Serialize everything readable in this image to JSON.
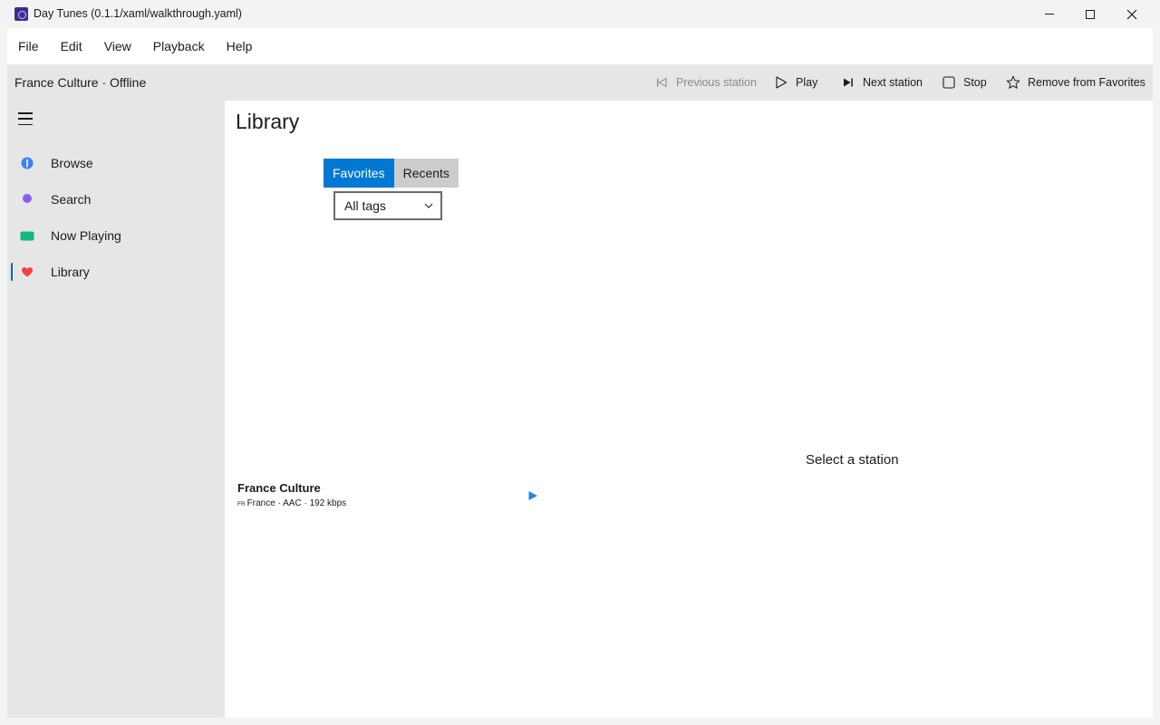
{
  "window": {
    "title": "Day Tunes (0.1.1/xaml/walkthrough.yaml)"
  },
  "menu": {
    "items": [
      "File",
      "Edit",
      "View",
      "Playback",
      "Help"
    ]
  },
  "toolbar": {
    "status": "France Culture · Offline",
    "previous_label": "Previous station",
    "play_label": "Play",
    "next_label": "Next station",
    "stop_label": "Stop",
    "favorite_label": "Remove from Favorites"
  },
  "nav": {
    "items": [
      {
        "label": "Browse",
        "icon": "compass-icon",
        "color": "#3b82f6"
      },
      {
        "label": "Search",
        "icon": "search-icon",
        "color": "#8b5cf6"
      },
      {
        "label": "Now Playing",
        "icon": "now-playing-icon",
        "color": "#10b981"
      },
      {
        "label": "Library",
        "icon": "heart-icon",
        "color": "#ef4444"
      }
    ],
    "selected": "Library"
  },
  "page": {
    "title": "Library",
    "tabs": [
      "Favorites",
      "Recents"
    ],
    "active_tab": "Favorites",
    "tag_filter": "All tags",
    "stations": [
      {
        "name": "France Culture",
        "country_code": "FR",
        "meta": "France · AAC · 192 kbps"
      }
    ],
    "detail_placeholder": "Select a station"
  },
  "colors": {
    "accent": "#0078d4",
    "nav_indicator": "#0067c0",
    "play_arrow": "#1e88e5"
  }
}
